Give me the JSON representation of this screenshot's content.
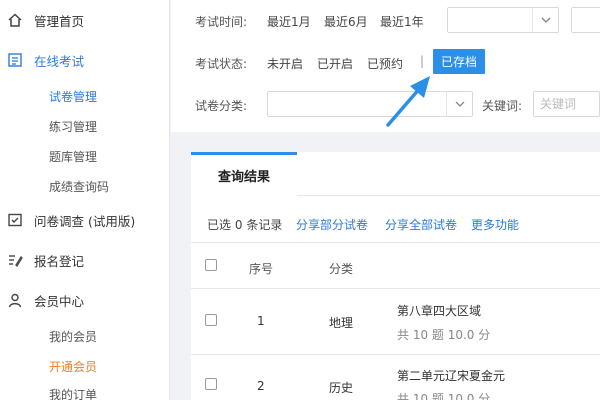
{
  "sidebar": {
    "home": "管理首页",
    "online_exam": "在线考试",
    "exam_sub": [
      "试卷管理",
      "练习管理",
      "题库管理",
      "成绩查询码"
    ],
    "survey": "问卷调查 (试用版)",
    "signup": "报名登记",
    "member": "会员中心",
    "member_sub": [
      "我的会员",
      "开通会员",
      "我的订单"
    ]
  },
  "filter": {
    "time_label": "考试时间:",
    "time_options": [
      "最近1月",
      "最近6月",
      "最近1年"
    ],
    "status_label": "考试状态:",
    "status_options": [
      "未开启",
      "已开启",
      "已预约"
    ],
    "separator": "|",
    "status_selected": "已存档",
    "category_label": "试卷分类:",
    "keyword_label": "关键词:",
    "keyword_placeholder": "关键词"
  },
  "results": {
    "tab": "查询结果",
    "selected_prefix": "已选",
    "selected_count": "0",
    "selected_suffix": "条记录",
    "share_some": "分享部分试卷",
    "share_all": "分享全部试卷",
    "more": "更多功能",
    "columns": [
      "序号",
      "分类"
    ],
    "rows": [
      {
        "index": "1",
        "category": "地理",
        "title": "第八章四大区域",
        "meta": "共 10 题 10.0 分"
      },
      {
        "index": "2",
        "category": "历史",
        "title": "第二单元辽宋夏金元",
        "meta": "共 10 题 10.0 分"
      }
    ]
  },
  "colors": {
    "accent": "#2b8fe8",
    "link": "#2b7bd6",
    "orange": "#f07c25"
  }
}
